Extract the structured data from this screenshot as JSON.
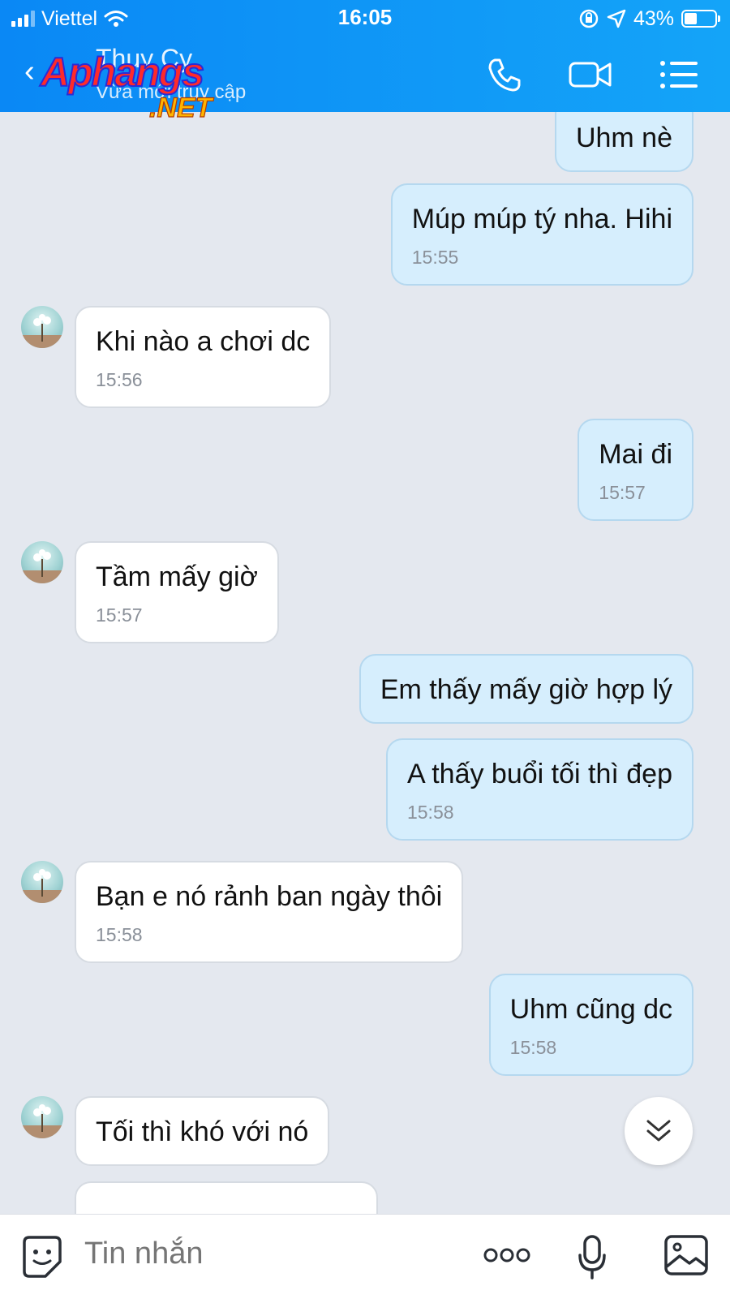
{
  "status_bar": {
    "carrier": "Viettel",
    "time": "16:05",
    "battery": "43%",
    "battery_level": 0.43
  },
  "header": {
    "contact_name": "Thuy Cy",
    "contact_status": "Vừa mới truy cập",
    "watermark_main": "Aphangs",
    "watermark_sub": ".NET",
    "icons": [
      "back-icon",
      "phone-icon",
      "video-icon",
      "menu-icon"
    ]
  },
  "messages": [
    {
      "from": "me",
      "text": "Uhm nè",
      "time": ""
    },
    {
      "from": "me",
      "text": "Múp múp tý nha. Hihi",
      "time": "15:55"
    },
    {
      "from": "them",
      "text": "Khi nào a chơi dc",
      "time": "15:56"
    },
    {
      "from": "me",
      "text": "Mai đi",
      "time": "15:57"
    },
    {
      "from": "them",
      "text": "Tầm mấy giờ",
      "time": "15:57"
    },
    {
      "from": "me",
      "text": "Em thấy mấy giờ hợp lý",
      "time": ""
    },
    {
      "from": "me",
      "text": "A thấy buổi tối thì đẹp",
      "time": "15:58"
    },
    {
      "from": "them",
      "text": "Bạn e nó rảnh ban ngày thôi",
      "time": "15:58"
    },
    {
      "from": "me",
      "text": "Uhm cũng dc",
      "time": "15:58"
    },
    {
      "from": "them",
      "text": "Tối thì khó với nó",
      "time": ""
    }
  ],
  "input": {
    "placeholder": "Tin nhắn",
    "icons": [
      "sticker-icon",
      "more-icon",
      "microphone-icon",
      "image-icon"
    ]
  },
  "colors": {
    "header_blue": "#0a88f5",
    "my_bubble": "#d6eefd",
    "their_bubble": "#ffffff",
    "chat_background": "#e4e8ef"
  }
}
